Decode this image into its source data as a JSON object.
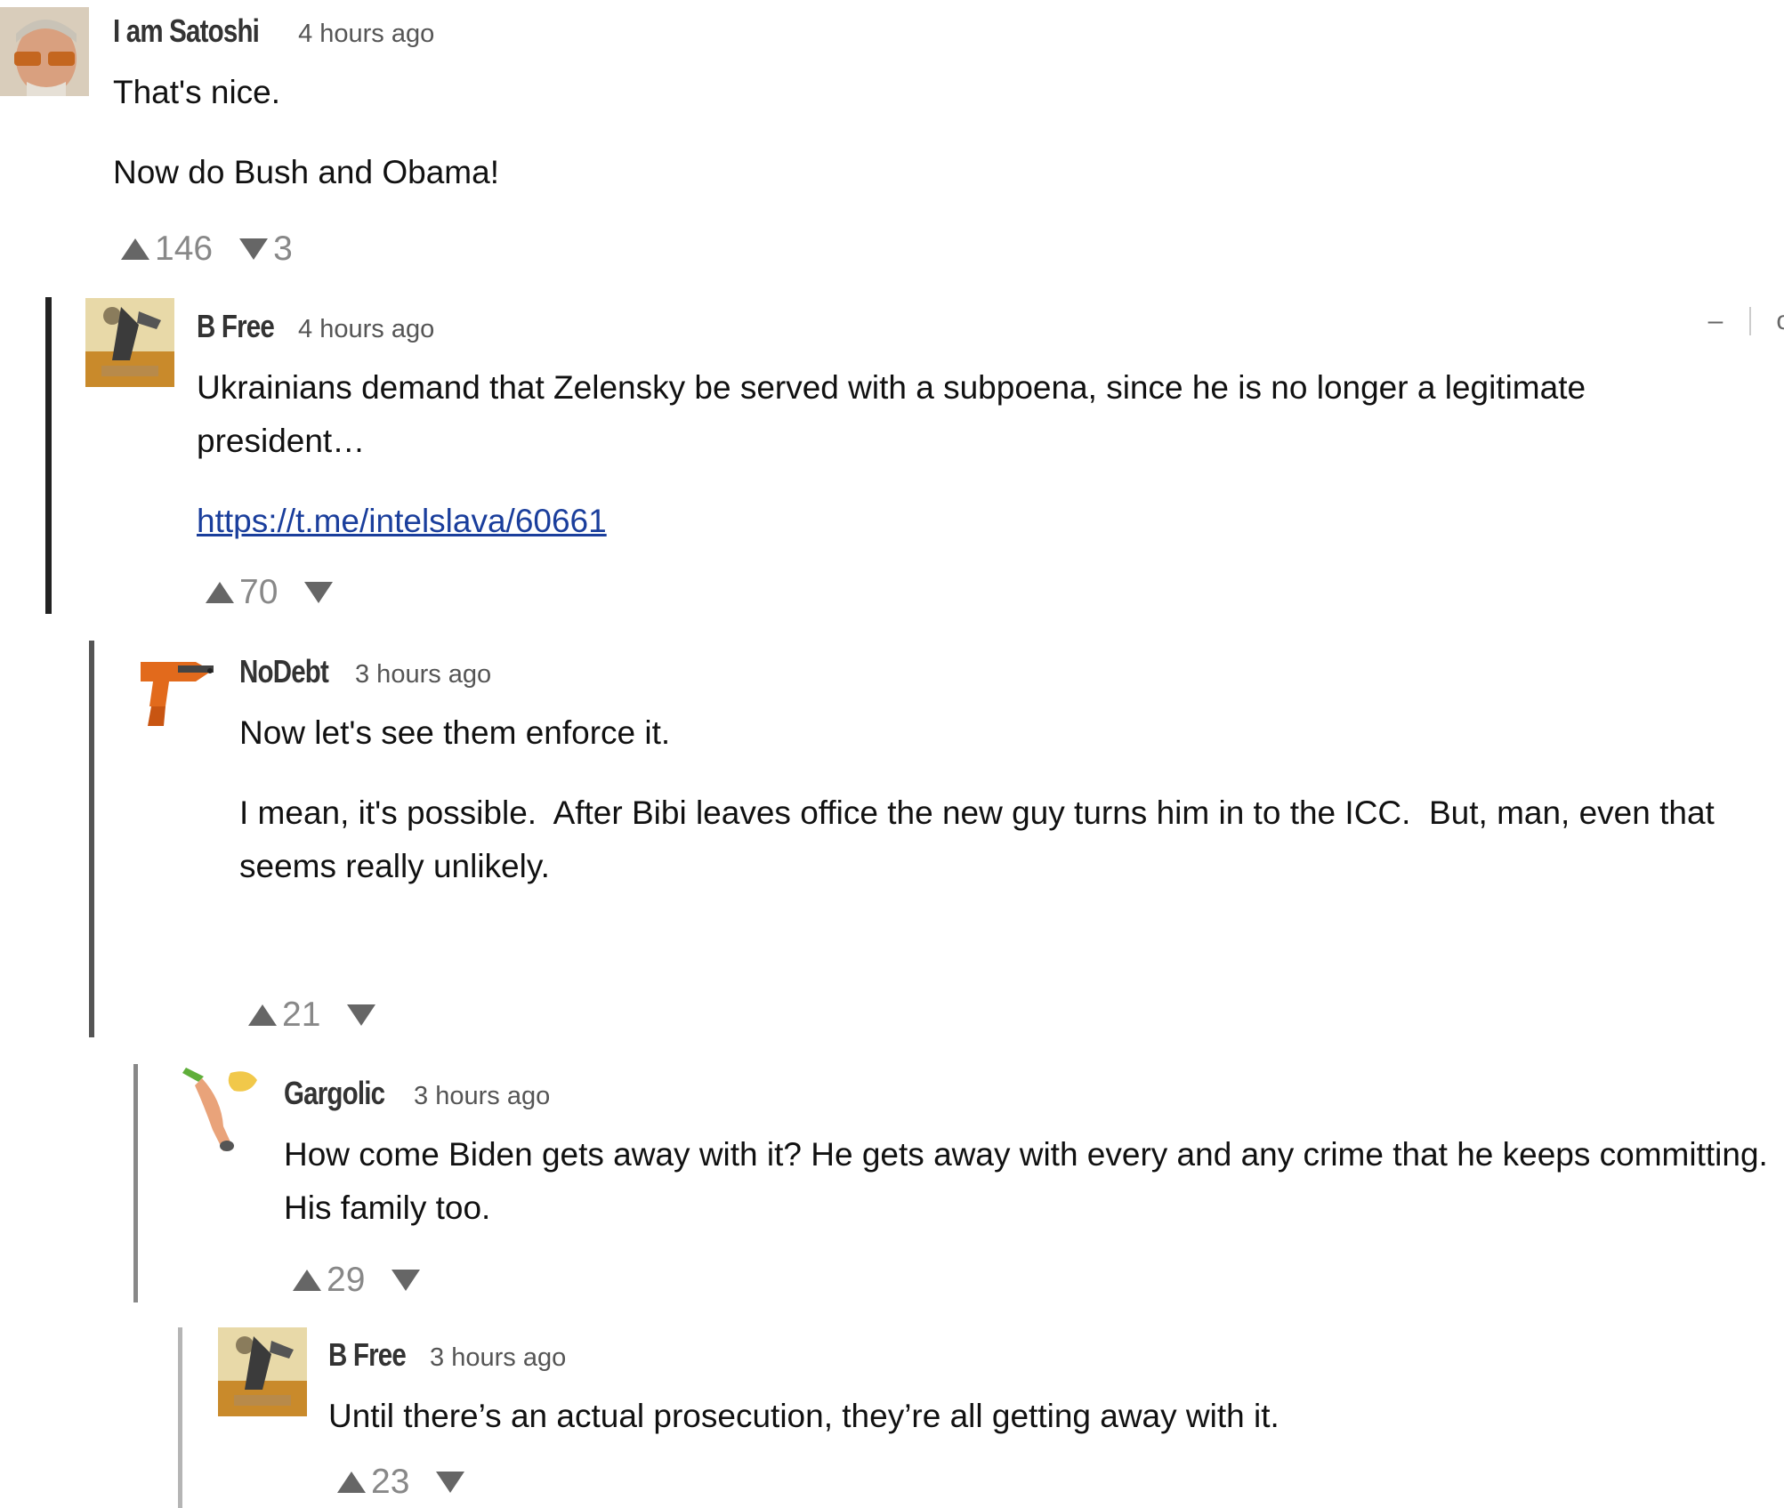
{
  "comments": [
    {
      "author": "I am Satoshi",
      "time": "4 hours ago",
      "paragraphs": [
        "That's nice.",
        "Now do Bush and Obama!"
      ],
      "up": "146",
      "down": "3"
    },
    {
      "author": "B Free",
      "time": "4 hours ago",
      "paragraphs": [
        "Ukrainians demand that Zelensky be served with a subpoena, since he is no longer a legitimate president…"
      ],
      "link": "https://t.me/intelslava/60661",
      "up": "70",
      "down": "",
      "collapse_label": "–",
      "share_label": "o"
    },
    {
      "author": "NoDebt",
      "time": "3 hours ago",
      "paragraphs": [
        "Now let's see them enforce it.",
        "I mean, it's possible.  After Bibi leaves office the new guy turns him in to the ICC.  But, man, even that seems really unlikely."
      ],
      "up": "21",
      "down": ""
    },
    {
      "author": "Gargolic",
      "time": "3 hours ago",
      "paragraphs": [
        "How come Biden gets away with it? He gets away with every and any crime that he keeps committing. His family too."
      ],
      "up": "29",
      "down": ""
    },
    {
      "author": "B Free",
      "time": "3 hours ago",
      "paragraphs": [
        "Until there’s an actual prosecution, they’re all getting away with it."
      ],
      "up": "23",
      "down": ""
    }
  ],
  "colors": {
    "thread_bar_1": "#222222",
    "thread_bar_2": "#555555",
    "thread_bar_3": "#888888",
    "thread_bar_4": "#b5b5b5",
    "link": "#1a3e9c"
  }
}
